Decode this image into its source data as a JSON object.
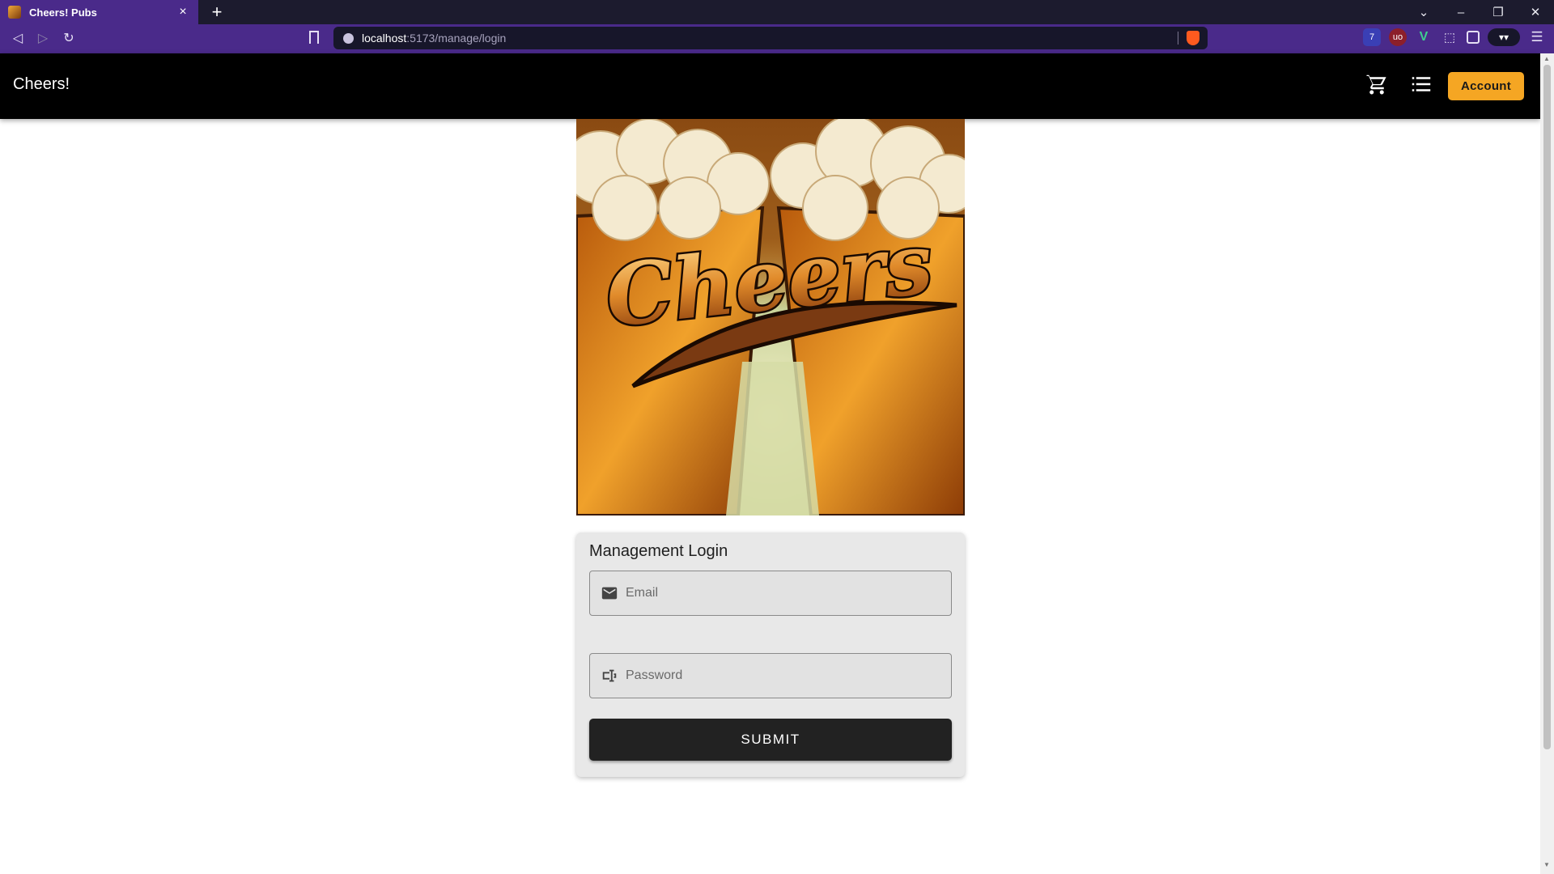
{
  "browser": {
    "tab_title": "Cheers! Pubs",
    "tab_close": "×",
    "new_tab": "+",
    "url_host": "localhost",
    "url_path": ":5173/manage/login",
    "ext_badge": "7",
    "ext_ublock": "uo",
    "ext_vue": "V",
    "win_minimize": "–",
    "win_restore": "❐",
    "win_close": "✕",
    "tab_list": "⌄",
    "back": "◁",
    "forward": "▷",
    "reload": "↻",
    "menu": "☰"
  },
  "appbar": {
    "brand": "Cheers!",
    "account_label": "Account"
  },
  "hero": {
    "logo_text": "Cheers"
  },
  "login": {
    "title": "Management Login",
    "email_placeholder": "Email",
    "password_placeholder": "Password",
    "submit_label": "SUBMIT"
  },
  "colors": {
    "appbar": "#000000",
    "accent": "#f5a623",
    "browser_chrome": "#4a2a8a",
    "submit_bg": "#222222"
  },
  "icons": {
    "cart": "cart-icon",
    "list": "list-icon",
    "email": "email-icon",
    "password": "password-icon"
  }
}
